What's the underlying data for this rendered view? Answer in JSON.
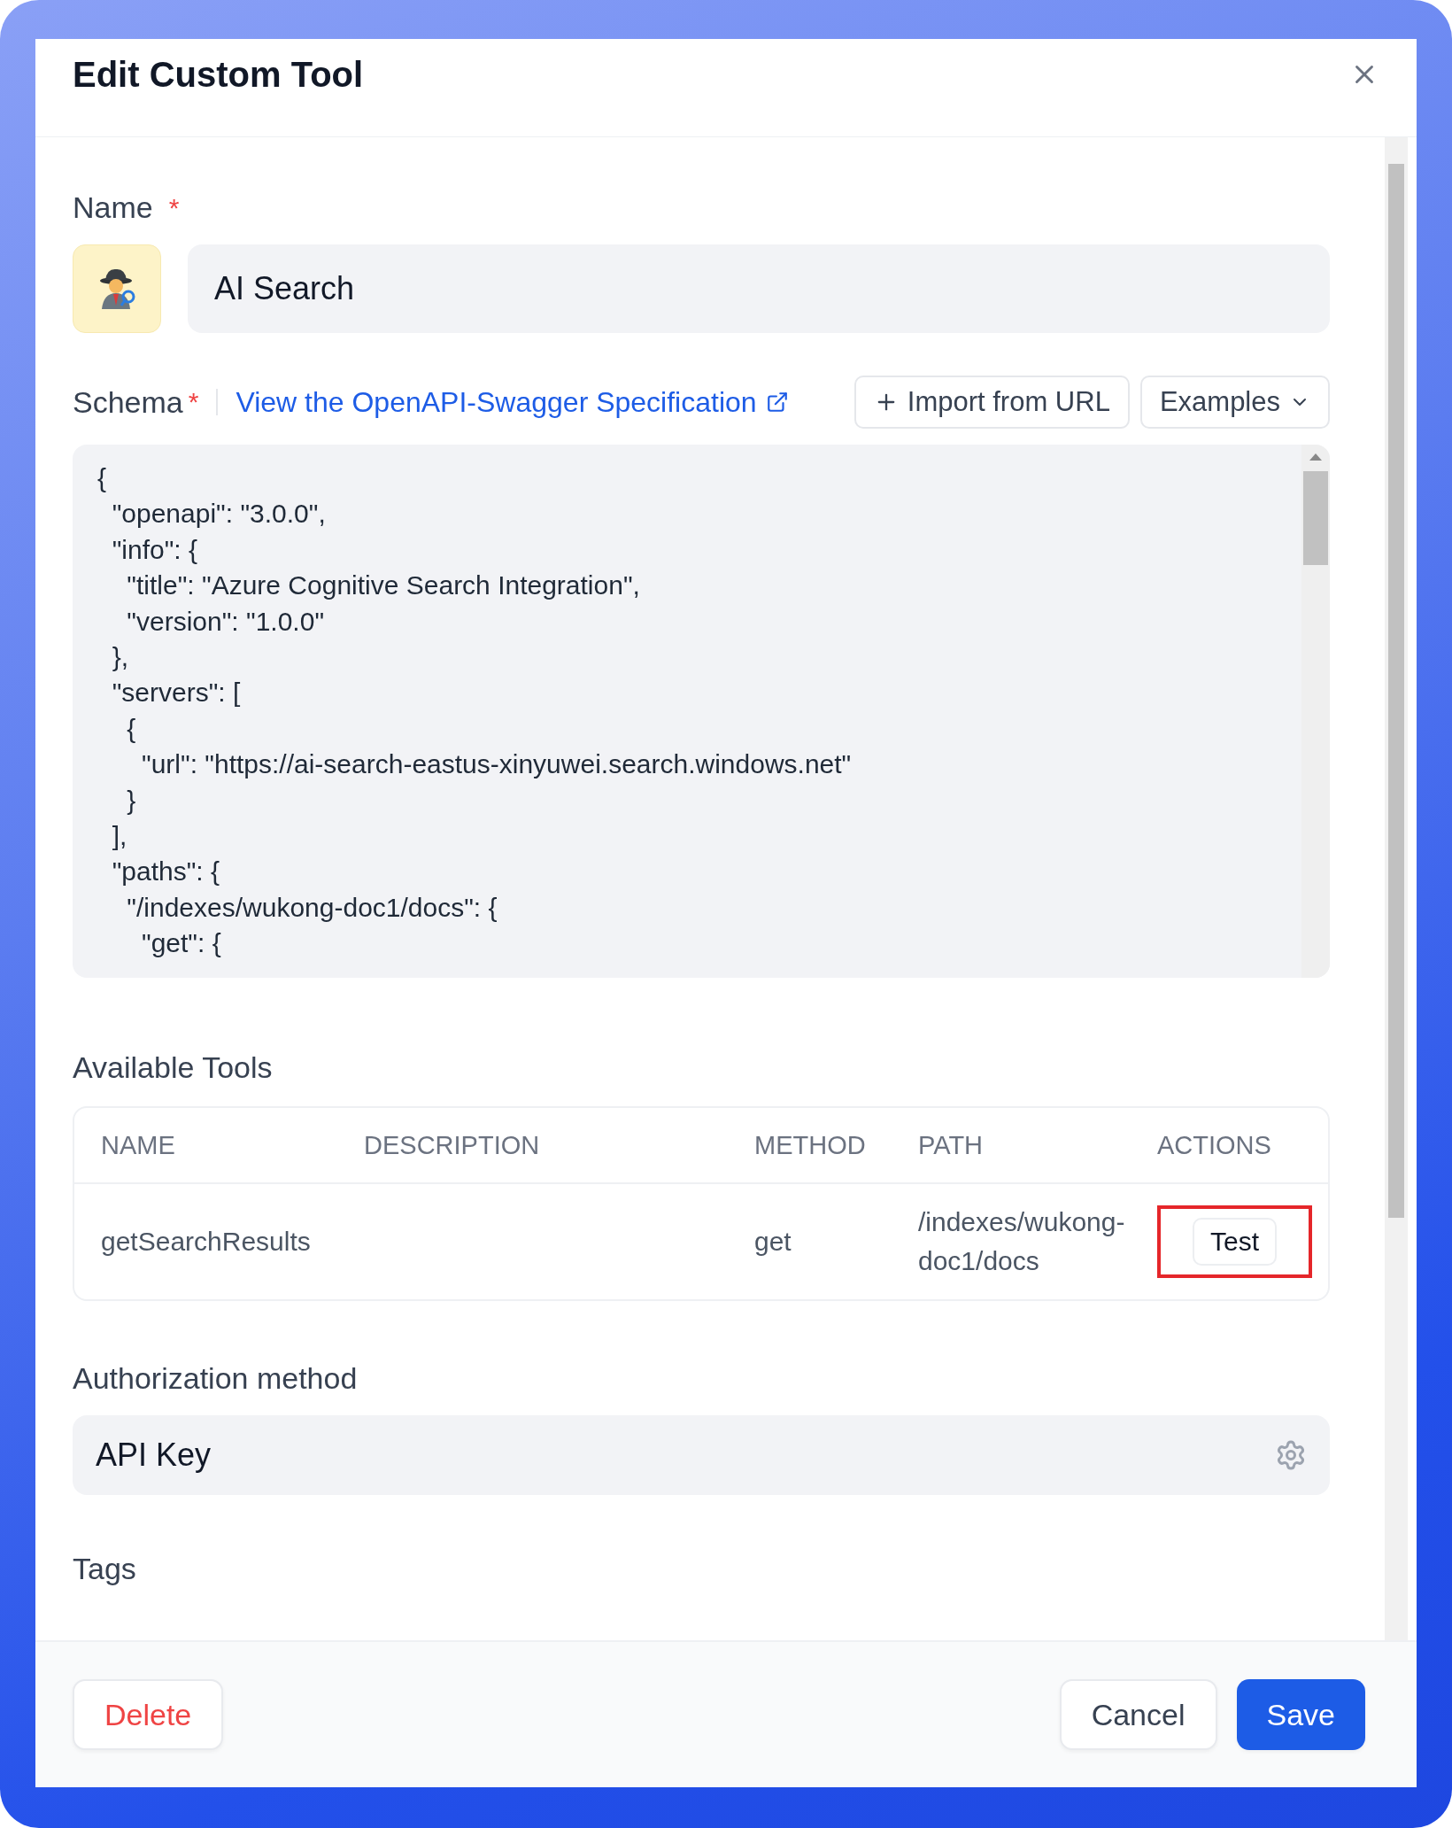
{
  "dialog": {
    "title": "Edit Custom Tool"
  },
  "name_field": {
    "label": "Name",
    "required_mark": "*",
    "value": "AI Search"
  },
  "schema": {
    "label": "Schema",
    "required_mark": "*",
    "link": "View the OpenAPI-Swagger Specification",
    "import_button": "Import from URL",
    "examples_button": "Examples",
    "code_lines": [
      "{",
      "  \"openapi\": \"3.0.0\",",
      "  \"info\": {",
      "    \"title\": \"Azure Cognitive Search Integration\",",
      "    \"version\": \"1.0.0\"",
      "  },",
      "  \"servers\": [",
      "    {",
      "      \"url\": \"https://ai-search-eastus-xinyuwei.search.windows.net\"",
      "    }",
      "  ],",
      "  \"paths\": {",
      "    \"/indexes/wukong-doc1/docs\": {",
      "      \"get\": {"
    ]
  },
  "available_tools": {
    "title": "Available Tools",
    "columns": [
      "NAME",
      "DESCRIPTION",
      "METHOD",
      "PATH",
      "ACTIONS"
    ],
    "rows": [
      {
        "name": "getSearchResults",
        "method": "get",
        "path": "/indexes/wukong-doc1/docs",
        "action": "Test",
        "highlighted": true
      }
    ]
  },
  "authorization": {
    "label": "Authorization method",
    "value": "API Key"
  },
  "tags": {
    "label": "Tags"
  },
  "footer": {
    "delete_button": "Delete",
    "cancel_button": "Cancel",
    "save_button": "Save"
  }
}
